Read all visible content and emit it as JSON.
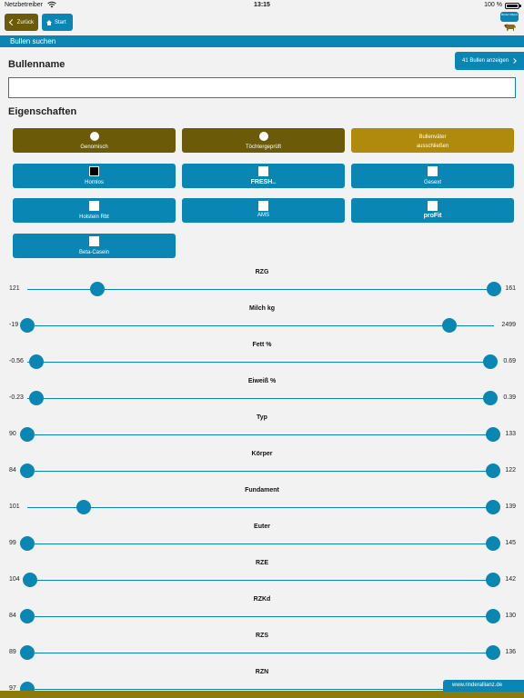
{
  "status_bar": {
    "carrier": "Netzbetreiber",
    "time": "13:15",
    "battery": "100 %"
  },
  "nav": {
    "back_label": "Zurück",
    "start_label": "Start",
    "logo_text": "Rinder Allianz"
  },
  "header": {
    "title": "Bullen suchen"
  },
  "bull_name": {
    "title": "Bullenname",
    "value": "",
    "placeholder": ""
  },
  "show_bulls": {
    "label": "41 Bullen anzeigen"
  },
  "properties": {
    "title": "Eigenschaften",
    "items": [
      {
        "label": "Genomisch",
        "control": "radio",
        "checked": false
      },
      {
        "label": "Töchtergeprüft",
        "control": "radio",
        "checked": false
      },
      {
        "label": "Bullenväter ausschließen",
        "line1": "Bullenväter",
        "line2": "ausschließen",
        "control": "toggle"
      },
      {
        "label": "Hornlos",
        "control": "checkbox",
        "checked": true
      },
      {
        "label": "FRESH",
        "control": "checkbox",
        "checked": false
      },
      {
        "label": "Gesext",
        "control": "checkbox",
        "checked": false
      },
      {
        "label": "Holstein Rbt",
        "control": "checkbox",
        "checked": false
      },
      {
        "label": "AMS",
        "control": "checkbox",
        "checked": false
      },
      {
        "label": "proFit",
        "control": "checkbox",
        "checked": false
      },
      {
        "label": "Beta-Casein",
        "control": "checkbox",
        "checked": false
      }
    ]
  },
  "sliders": [
    {
      "label": "RZG",
      "min": "121",
      "max": "161",
      "low_frac": 0.15,
      "high_frac": 1.0
    },
    {
      "label": "Milch kg",
      "min": "-19",
      "max": "2499",
      "low_frac": 0.0,
      "high_frac": 0.905
    },
    {
      "label": "Fett %",
      "min": "-0.56",
      "max": "0.69",
      "low_frac": 0.02,
      "high_frac": 0.993
    },
    {
      "label": "Eiweiß %",
      "min": "-0.23",
      "max": "0.39",
      "low_frac": 0.02,
      "high_frac": 0.993
    },
    {
      "label": "Typ",
      "min": "90",
      "max": "133",
      "low_frac": 0.0,
      "high_frac": 0.998
    },
    {
      "label": "Körper",
      "min": "84",
      "max": "122",
      "low_frac": 0.0,
      "high_frac": 0.998
    },
    {
      "label": "Fundament",
      "min": "101",
      "max": "139",
      "low_frac": 0.12,
      "high_frac": 0.998
    },
    {
      "label": "Euter",
      "min": "99",
      "max": "145",
      "low_frac": 0.0,
      "high_frac": 0.998
    },
    {
      "label": "RZE",
      "min": "104",
      "max": "142",
      "low_frac": 0.006,
      "high_frac": 0.998
    },
    {
      "label": "RZKd",
      "min": "84",
      "max": "130",
      "low_frac": 0.0,
      "high_frac": 0.998
    },
    {
      "label": "RZS",
      "min": "89",
      "max": "136",
      "low_frac": 0.0,
      "high_frac": 0.998
    },
    {
      "label": "RZN",
      "min": "97",
      "max": "",
      "low_frac": 0.0,
      "high_frac": 0.998
    }
  ],
  "footer": {
    "link": "www.rinderallianz.de"
  },
  "colors": {
    "primary_blue": "#0a86b4",
    "dark_gold": "#6b5a08",
    "light_gold": "#b08a0c"
  }
}
